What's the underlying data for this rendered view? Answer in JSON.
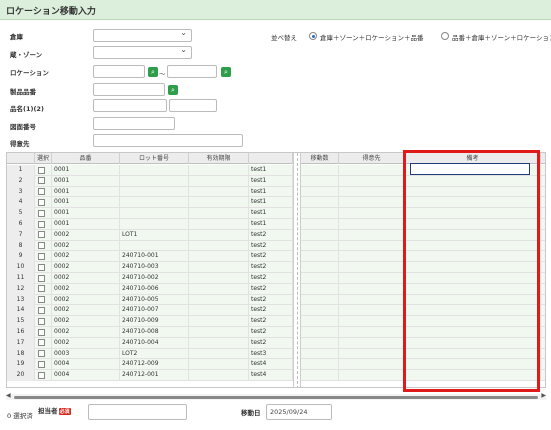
{
  "title": "ロケーション移動入力",
  "filters": {
    "warehouse_label": "倉庫",
    "zone_label": "蔵・ゾーン",
    "location_label": "ロケーション",
    "location_sep": "～",
    "product_label": "製品品番",
    "name_label": "品名(1)(2)",
    "drawing_label": "図面番号",
    "customer_label": "得意先"
  },
  "sort": {
    "label": "並べ替え",
    "option1": "倉庫＋ゾーン＋ロケーション＋品番",
    "option2": "品番＋倉庫＋ゾーン＋ロケーション"
  },
  "columns": {
    "select": "選択",
    "product": "品番",
    "lot": "ロット番号",
    "expiry": "有効期限",
    "qty": "移動数",
    "customer": "得意先",
    "note": "備考"
  },
  "rows": [
    {
      "n": "1",
      "product": "0001",
      "lot": "",
      "loc": "test1"
    },
    {
      "n": "2",
      "product": "0001",
      "lot": "",
      "loc": "test1"
    },
    {
      "n": "3",
      "product": "0001",
      "lot": "",
      "loc": "test1"
    },
    {
      "n": "4",
      "product": "0001",
      "lot": "",
      "loc": "test1"
    },
    {
      "n": "5",
      "product": "0001",
      "lot": "",
      "loc": "test1"
    },
    {
      "n": "6",
      "product": "0001",
      "lot": "",
      "loc": "test1"
    },
    {
      "n": "7",
      "product": "0002",
      "lot": "LOT1",
      "loc": "test2"
    },
    {
      "n": "8",
      "product": "0002",
      "lot": "",
      "loc": "test2"
    },
    {
      "n": "9",
      "product": "0002",
      "lot": "240710-001",
      "loc": "test2"
    },
    {
      "n": "10",
      "product": "0002",
      "lot": "240710-003",
      "loc": "test2"
    },
    {
      "n": "11",
      "product": "0002",
      "lot": "240710-002",
      "loc": "test2"
    },
    {
      "n": "12",
      "product": "0002",
      "lot": "240710-006",
      "loc": "test2"
    },
    {
      "n": "13",
      "product": "0002",
      "lot": "240710-005",
      "loc": "test2"
    },
    {
      "n": "14",
      "product": "0002",
      "lot": "240710-007",
      "loc": "test2"
    },
    {
      "n": "15",
      "product": "0002",
      "lot": "240710-009",
      "loc": "test2"
    },
    {
      "n": "16",
      "product": "0002",
      "lot": "240710-008",
      "loc": "test2"
    },
    {
      "n": "17",
      "product": "0002",
      "lot": "240710-004",
      "loc": "test2"
    },
    {
      "n": "18",
      "product": "0003",
      "lot": "LOT2",
      "loc": "test3"
    },
    {
      "n": "19",
      "product": "0004",
      "lot": "240712-009",
      "loc": "test4"
    },
    {
      "n": "20",
      "product": "0004",
      "lot": "240712-001",
      "loc": "test4"
    }
  ],
  "footer": {
    "selected_count": "0 選択済",
    "staff_label": "担当者",
    "required_badge": "必須",
    "move_date_label": "移動日",
    "move_date_value": "2025/09/24"
  },
  "colors": {
    "accent": "#2e9e4a",
    "highlight": "#e01a1a"
  }
}
